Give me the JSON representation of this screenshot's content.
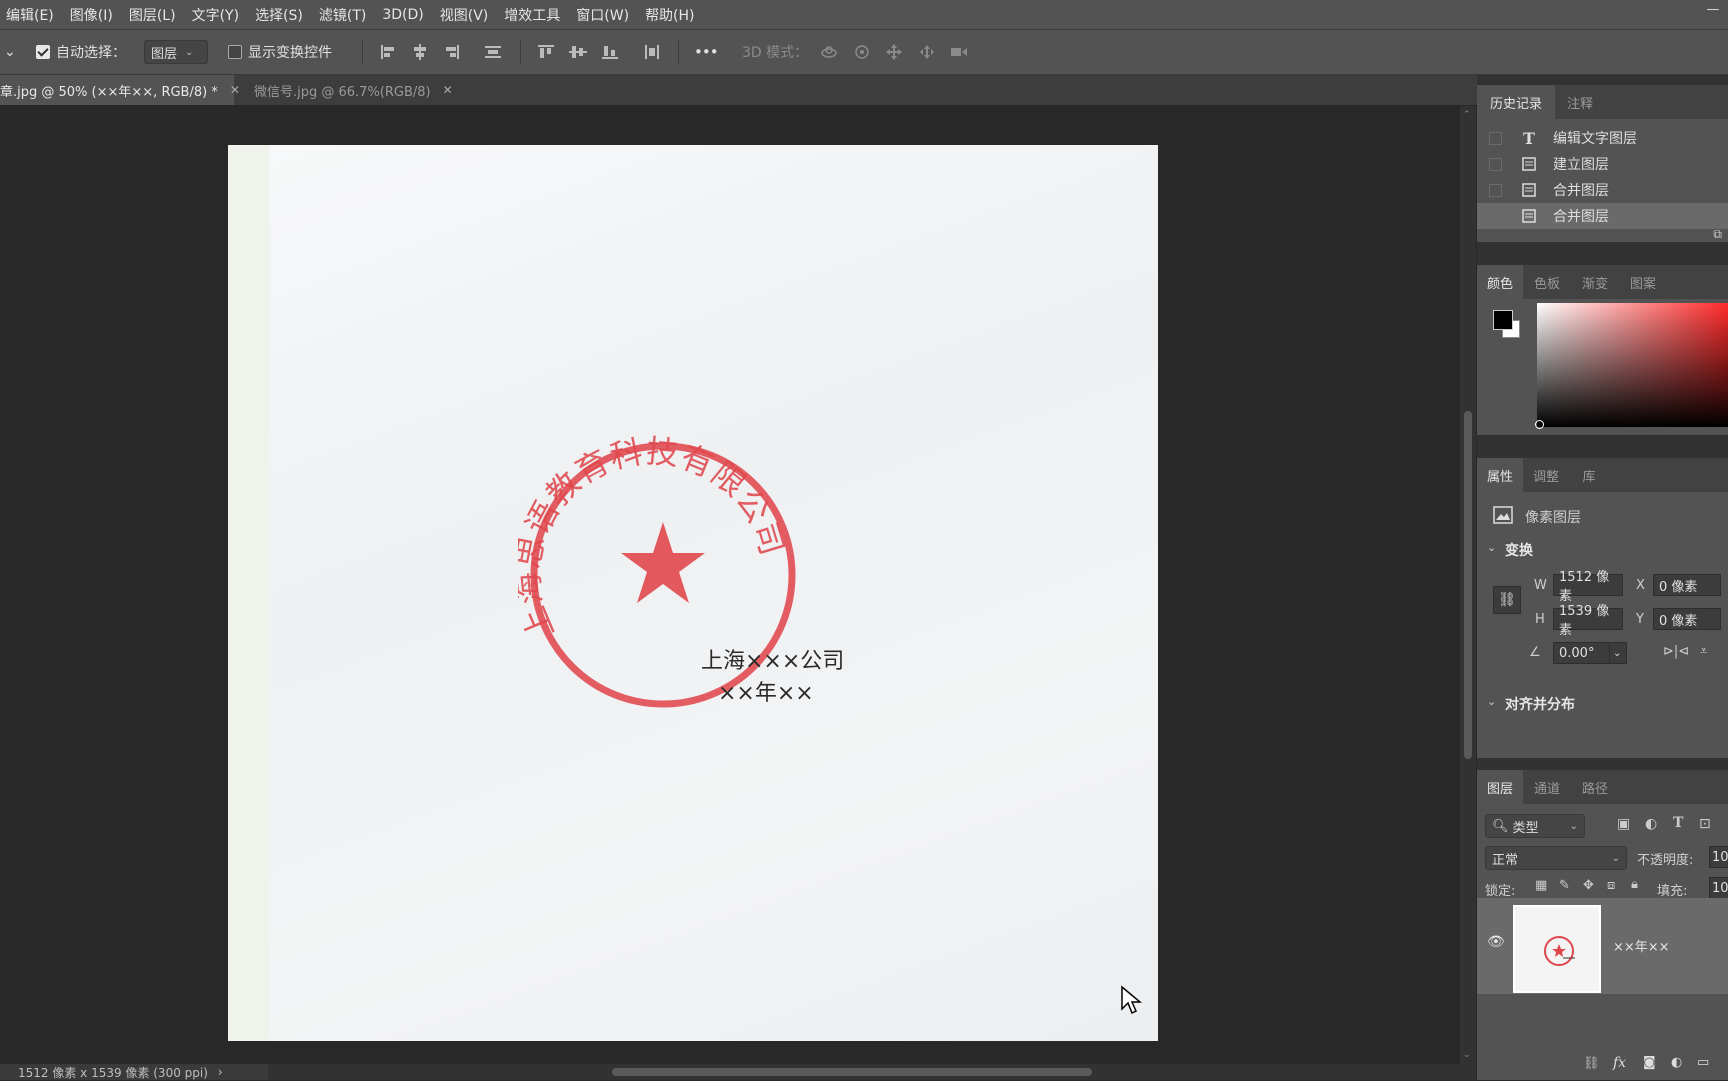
{
  "menu": [
    "编辑(E)",
    "图像(I)",
    "图层(L)",
    "文字(Y)",
    "选择(S)",
    "滤镜(T)",
    "3D(D)",
    "视图(V)",
    "增效工具",
    "窗口(W)",
    "帮助(H)"
  ],
  "options": {
    "auto_select_label": "自动选择：",
    "auto_select_checked": true,
    "auto_select_value": "图层",
    "show_transform_label": "显示变换控件",
    "more": "•••",
    "mode_3d_label": "3D 模式："
  },
  "tabs": [
    {
      "label": "章.jpg @ 50% (××年××, RGB/8) *",
      "active": true
    },
    {
      "label": "微信号.jpg @ 66.7%(RGB/8)",
      "active": false
    }
  ],
  "canvas": {
    "seal_arc_text": "上海思语教育科技有限公司",
    "overlay_line1": "上海×××公司",
    "overlay_line2": "××年××"
  },
  "status": {
    "doc_info": "1512 像素 x 1539 像素 (300 ppi)",
    "arrow": "›"
  },
  "history_panel": {
    "tabs": [
      "历史记录",
      "注释"
    ],
    "items": [
      {
        "icon": "T",
        "label": "编辑文字图层"
      },
      {
        "icon": "doc",
        "label": "建立图层"
      },
      {
        "icon": "doc",
        "label": "合并图层"
      },
      {
        "icon": "doc",
        "label": "合并图层"
      }
    ]
  },
  "color_panel": {
    "tabs": [
      "颜色",
      "色板",
      "渐变",
      "图案"
    ],
    "foreground": "#000000",
    "background": "#ffffff",
    "hue": "#ff2a2a"
  },
  "properties_panel": {
    "tabs": [
      "属性",
      "调整",
      "库"
    ],
    "layer_type": "像素图层",
    "transform_title": "变换",
    "w_label": "W",
    "w_value": "1512 像素",
    "x_label": "X",
    "x_value": "0 像素",
    "h_label": "H",
    "h_value": "1539 像素",
    "y_label": "Y",
    "y_value": "0 像素",
    "angle_value": "0.00°",
    "align_title": "对齐并分布"
  },
  "layers_panel": {
    "tabs": [
      "图层",
      "通道",
      "路径"
    ],
    "filter_label": "类型",
    "blend_mode": "正常",
    "opacity_label": "不透明度:",
    "opacity_value": "10",
    "lock_label": "锁定:",
    "fill_label": "填充:",
    "fill_value": "10",
    "layer_name": "××年××"
  }
}
